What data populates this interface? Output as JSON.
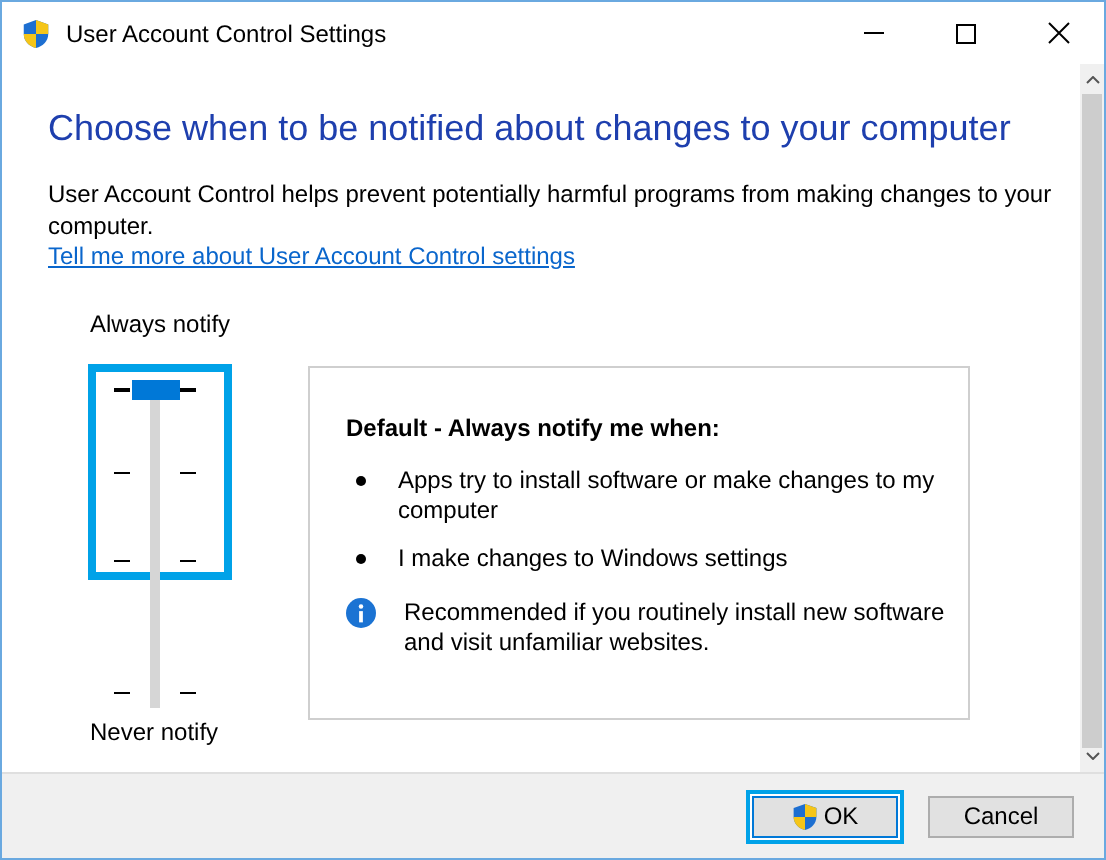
{
  "window": {
    "title": "User Account Control Settings"
  },
  "heading": "Choose when to be notified about changes to your computer",
  "description": "User Account Control helps prevent potentially harmful programs from making changes to your computer.",
  "link": "Tell me more about User Account Control settings",
  "slider": {
    "top_label": "Always notify",
    "bottom_label": "Never notify",
    "level": 1,
    "highlighted": true
  },
  "info": {
    "title": "Default - Always notify me when:",
    "bullets": [
      "Apps try to install software or make changes to my computer",
      "I make changes to Windows settings"
    ],
    "note": "Recommended if you routinely install new software and visit unfamiliar websites."
  },
  "buttons": [
    {
      "label": "OK",
      "kind": "shield",
      "highlighted": true
    },
    {
      "label": "Cancel",
      "kind": "plain",
      "highlighted": false
    }
  ]
}
